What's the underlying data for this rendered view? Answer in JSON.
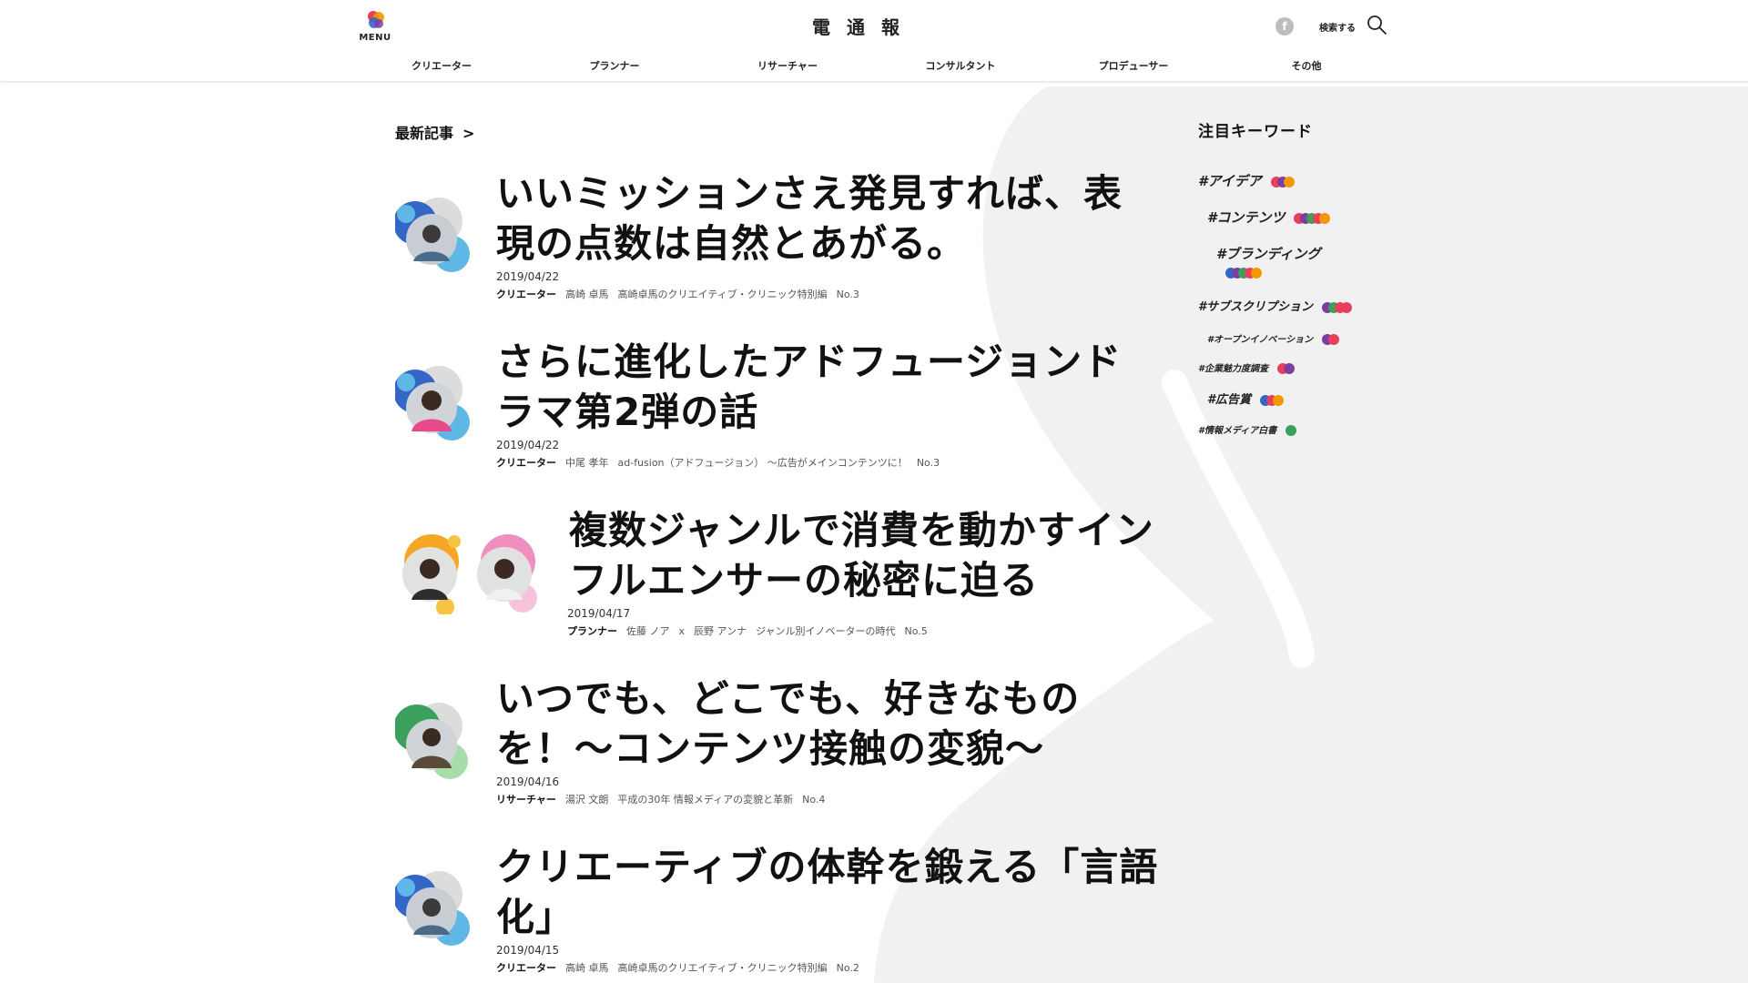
{
  "header": {
    "menu_label": "MENU",
    "site_title": "電通報",
    "facebook_glyph": "f",
    "search_label": "検索する",
    "nav": [
      "クリエーター",
      "プランナー",
      "リサーチャー",
      "コンサルタント",
      "プロデューサー",
      "その他"
    ]
  },
  "main": {
    "section_heading": "最新記事",
    "section_chevron": ">",
    "articles": [
      {
        "title": "いいミッションさえ発見すれば、表現の点数は自然とあがる。",
        "date": "2019/04/22",
        "category": "クリエーター",
        "author": "高崎 卓馬",
        "series": "高崎卓馬のクリエイティブ・クリニック特別編",
        "number": "No.3"
      },
      {
        "title": "さらに進化したアドフュージョンドラマ第2弾の話",
        "date": "2019/04/22",
        "category": "クリエーター",
        "author": "中尾 孝年",
        "series": "ad-fusion（アドフュージョン） 〜広告がメインコンテンツに！",
        "number": "No.3"
      },
      {
        "title": "複数ジャンルで消費を動かすインフルエンサーの秘密に迫る",
        "date": "2019/04/17",
        "category": "プランナー",
        "author": "佐藤 ノア",
        "author_sep": "x",
        "author2": "辰野 アンナ",
        "series": "ジャンル別イノベーターの時代",
        "number": "No.5"
      },
      {
        "title": "いつでも、どこでも、好きなものを！〜コンテンツ接触の変貌〜",
        "date": "2019/04/16",
        "category": "リサーチャー",
        "author": "湯沢 文朗",
        "series": "平成の30年 情報メディアの変貌と革新",
        "number": "No.4"
      },
      {
        "title": "クリエーティブの体幹を鍛える「言語化」",
        "date": "2019/04/15",
        "category": "クリエーター",
        "author": "高崎 卓馬",
        "series": "高崎卓馬のクリエイティブ・クリニック特別編",
        "number": "No.2"
      }
    ]
  },
  "sidebar": {
    "title": "注目キーワード",
    "keywords": [
      {
        "label": "#アイデア",
        "dots": [
          "#e8405a",
          "#7b3fa0",
          "#f39800"
        ]
      },
      {
        "label": "#コンテンツ",
        "dots": [
          "#e8405a",
          "#7b3fa0",
          "#3aa05b",
          "#e8405a",
          "#f39800"
        ]
      },
      {
        "label": "#ブランディング",
        "dots": [
          "#3466c8",
          "#7b3fa0",
          "#3aa05b",
          "#e8405a",
          "#f39800"
        ]
      },
      {
        "label": "#サブスクリプション",
        "dots": [
          "#7b3fa0",
          "#3aa05b",
          "#e8405a",
          "#e8405a"
        ]
      },
      {
        "label": "#オープンイノベーション",
        "dots": [
          "#7b3fa0",
          "#e8405a"
        ]
      },
      {
        "label": "#企業魅力度調査",
        "dots": [
          "#e8405a",
          "#7b3fa0"
        ]
      },
      {
        "label": "#広告賞",
        "dots": [
          "#3466c8",
          "#e8405a",
          "#f39800"
        ]
      },
      {
        "label": "#情報メディア白書",
        "dots": [
          "#3aa05b"
        ]
      }
    ]
  },
  "colors": {
    "blue": "#3466c8",
    "light_blue": "#5fb7e5",
    "green": "#3aa05b",
    "pink": "#ef8fc0",
    "yellow": "#f5c542",
    "blob_gray": "#f1f1f1"
  }
}
